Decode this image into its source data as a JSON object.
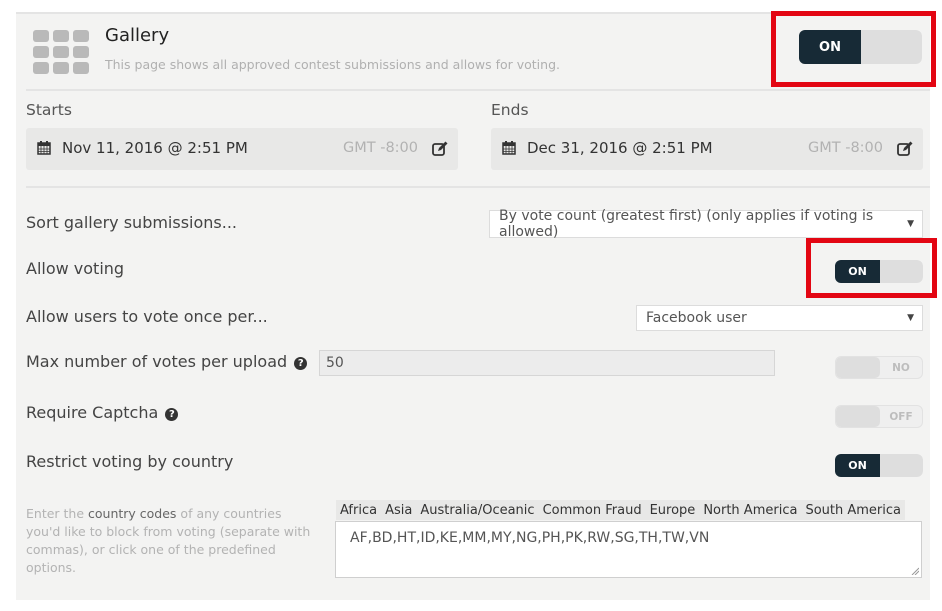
{
  "header": {
    "title": "Gallery",
    "subtitle": "This page shows all approved contest submissions and allows for voting.",
    "page_toggle": {
      "label": "ON",
      "state": "on"
    }
  },
  "dates": {
    "starts": {
      "label": "Starts",
      "value": "Nov 11, 2016 @ 2:51 PM",
      "timezone": "GMT -8:00"
    },
    "ends": {
      "label": "Ends",
      "value": "Dec 31, 2016 @ 2:51 PM",
      "timezone": "GMT -8:00"
    }
  },
  "settings": {
    "sort": {
      "label": "Sort gallery submissions...",
      "value": "By vote count (greatest first) (only applies if voting is allowed)"
    },
    "allow_voting": {
      "label": "Allow voting",
      "toggle_label": "ON",
      "state": "on"
    },
    "vote_once_per": {
      "label": "Allow users to vote once per...",
      "value": "Facebook user"
    },
    "max_votes": {
      "label": "Max number of votes per upload",
      "value": "50",
      "toggle_label": "NO",
      "state": "off"
    },
    "captcha": {
      "label": "Require Captcha",
      "toggle_label": "OFF",
      "state": "off"
    },
    "restrict_country": {
      "label": "Restrict voting by country",
      "toggle_label": "ON",
      "state": "on"
    }
  },
  "country": {
    "hint_pre": "Enter the ",
    "hint_bold": "country codes",
    "hint_post": " of any countries you'd like to block from voting (separate with commas), or click one of the predefined options.",
    "presets": [
      "Africa",
      "Asia",
      "Australia/Oceanic",
      "Common Fraud",
      "Europe",
      "North America",
      "South America"
    ],
    "codes": "AF,BD,HT,ID,KE,MM,MY,NG,PH,PK,RW,SG,TH,TW,VN"
  },
  "icons": {
    "help": "?",
    "caret": "▼"
  },
  "colors": {
    "highlight": "#e30613",
    "toggle_on": "#172a36",
    "panel": "#f3f3f2"
  }
}
